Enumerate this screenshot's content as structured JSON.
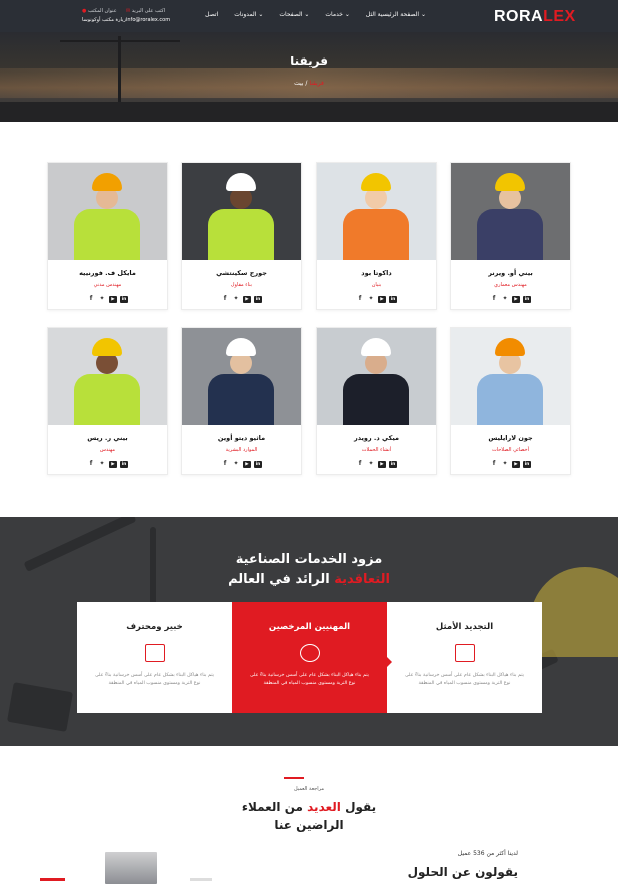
{
  "header": {
    "logo_main": "RORA",
    "logo_accent": "LEX",
    "menu": [
      "الصفحة الرئيسية الثل",
      "خدمات",
      "الصفحات",
      "المدونات",
      "اتصل"
    ],
    "contact": {
      "address_label": "عنوان المكتب",
      "address_value": "زيارة مكتب أوكونوسا",
      "email_label": "اكتب على البريد",
      "email_value": "info@roralex.com"
    }
  },
  "hero": {
    "title": "فريقنا",
    "breadcrumb_home": "بيت",
    "breadcrumb_sep": "/",
    "breadcrumb_current": "فريقنا"
  },
  "team": [
    {
      "name": "بيني أو. ويرنر",
      "role": "مهندس معماري"
    },
    {
      "name": "داكوتا بود",
      "role": "بنيان"
    },
    {
      "name": "جورج سكينتشي",
      "role": "بناء مقاول"
    },
    {
      "name": "مايكل ف. فورنييه",
      "role": "مهندس مدني"
    },
    {
      "name": "جون لارايليس",
      "role": "أخصائي الصلاحات"
    },
    {
      "name": "ميكي د. رويدر",
      "role": "أنشاء الحملات"
    },
    {
      "name": "ماثيو ديتو أوين",
      "role": "الموارد البشرية"
    },
    {
      "name": "بيني ر. ريس",
      "role": "مهندس"
    }
  ],
  "social_icons": [
    "facebook-icon",
    "twitter-icon",
    "youtube-icon",
    "linkedin-icon"
  ],
  "services": {
    "title_line1": "مزود الخدمات الصناعية",
    "title_line2_highlight": "التعاقدية",
    "title_line2_rest": "الرائد في العالم",
    "cards": [
      {
        "title": "التجديد الأمثل",
        "desc": "يتم بناء هياكل البناء بشكل عام على أسس خرسانية بناءً على نوع التربة ومستوى منسوب المياه في المنطقة",
        "icon": "crane-icon",
        "active": false
      },
      {
        "title": "المهنيين المرخصين",
        "desc": "يتم بناء هياكل البناء بشكل عام على أسس خرسانية بناءً على نوع التربة ومستوى منسوب المياه في المنطقة",
        "icon": "helmet-icon",
        "active": true
      },
      {
        "title": "خبير ومحترف",
        "desc": "يتم بناء هياكل البناء بشكل عام على أسس خرسانية بناءً على نوع التربة ومستوى منسوب المياه في المنطقة",
        "icon": "building-icon",
        "active": false
      }
    ]
  },
  "reviews": {
    "small_label": "مراجعة العميل",
    "title_pre": "يقول",
    "title_highlight": "العديد",
    "title_post": "من العملاء",
    "title_line2": "الراضين عنا",
    "count_text": "لدينا أكثر من 536 عميل",
    "heading": "يقولون عن الحلول"
  },
  "colors": {
    "accent": "#e01b22",
    "topbar": "#2b2f36",
    "dark_section": "#3b3c3e"
  }
}
